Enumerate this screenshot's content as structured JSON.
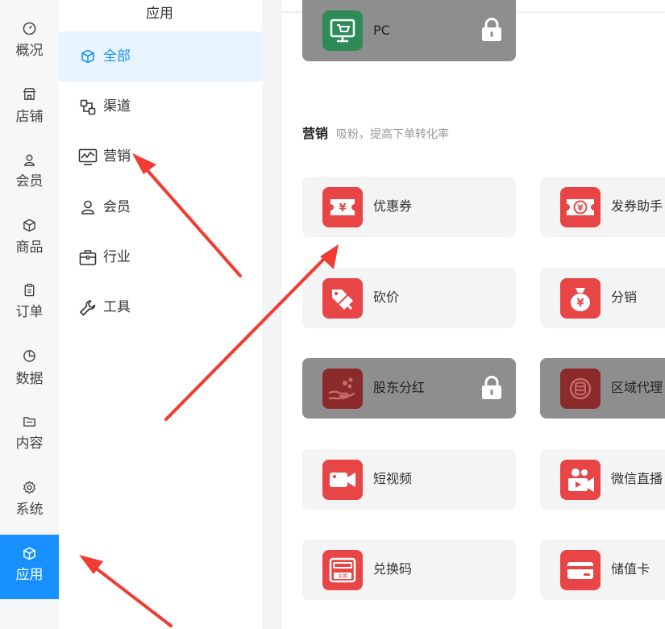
{
  "primary_nav": [
    {
      "label": "概况",
      "icon": "dashboard-icon"
    },
    {
      "label": "店铺",
      "icon": "store-icon"
    },
    {
      "label": "会员",
      "icon": "member-icon"
    },
    {
      "label": "商品",
      "icon": "product-box-icon"
    },
    {
      "label": "订单",
      "icon": "order-clipboard-icon"
    },
    {
      "label": "数据",
      "icon": "pie-chart-icon"
    },
    {
      "label": "内容",
      "icon": "folder-icon"
    },
    {
      "label": "系统",
      "icon": "gear-icon"
    },
    {
      "label": "应用",
      "icon": "cube-icon",
      "active": true
    }
  ],
  "secondary_nav": {
    "title": "应用",
    "items": [
      {
        "label": "全部",
        "icon": "cube-icon",
        "active": true
      },
      {
        "label": "渠道",
        "icon": "channel-icon"
      },
      {
        "label": "营销",
        "icon": "trend-chart-icon"
      },
      {
        "label": "会员",
        "icon": "member-icon"
      },
      {
        "label": "行业",
        "icon": "briefcase-icon"
      },
      {
        "label": "工具",
        "icon": "wrench-icon"
      }
    ]
  },
  "main": {
    "top_card": {
      "label": "PC",
      "icon": "pc-cart-icon",
      "locked": true,
      "icon_color": "#2e8b57"
    },
    "section": {
      "title": "营销",
      "desc": "吸粉，提高下单转化率"
    },
    "apps": [
      {
        "label": "优惠券",
        "icon": "coupon-icon",
        "locked": false
      },
      {
        "label": "发券助手",
        "icon": "coupon-helper-icon",
        "locked": false
      },
      {
        "label": "砍价",
        "icon": "bargain-tag-icon",
        "locked": false
      },
      {
        "label": "分销",
        "icon": "money-bag-icon",
        "locked": false
      },
      {
        "label": "股东分红",
        "icon": "dividend-icon",
        "locked": true
      },
      {
        "label": "区域代理",
        "icon": "region-agent-icon",
        "locked": true
      },
      {
        "label": "短视频",
        "icon": "video-camera-icon",
        "locked": false
      },
      {
        "label": "微信直播",
        "icon": "live-camera-icon",
        "locked": false
      },
      {
        "label": "兑换码",
        "icon": "redeem-code-icon",
        "locked": false
      },
      {
        "label": "储值卡",
        "icon": "stored-value-card-icon",
        "locked": false
      }
    ]
  },
  "colors": {
    "accent": "#1890ff",
    "accent_light": "#e8f4ff",
    "app_icon_red": "#e84646",
    "locked_card": "#8e8e8e",
    "annotation_arrow": "#f03c32"
  }
}
